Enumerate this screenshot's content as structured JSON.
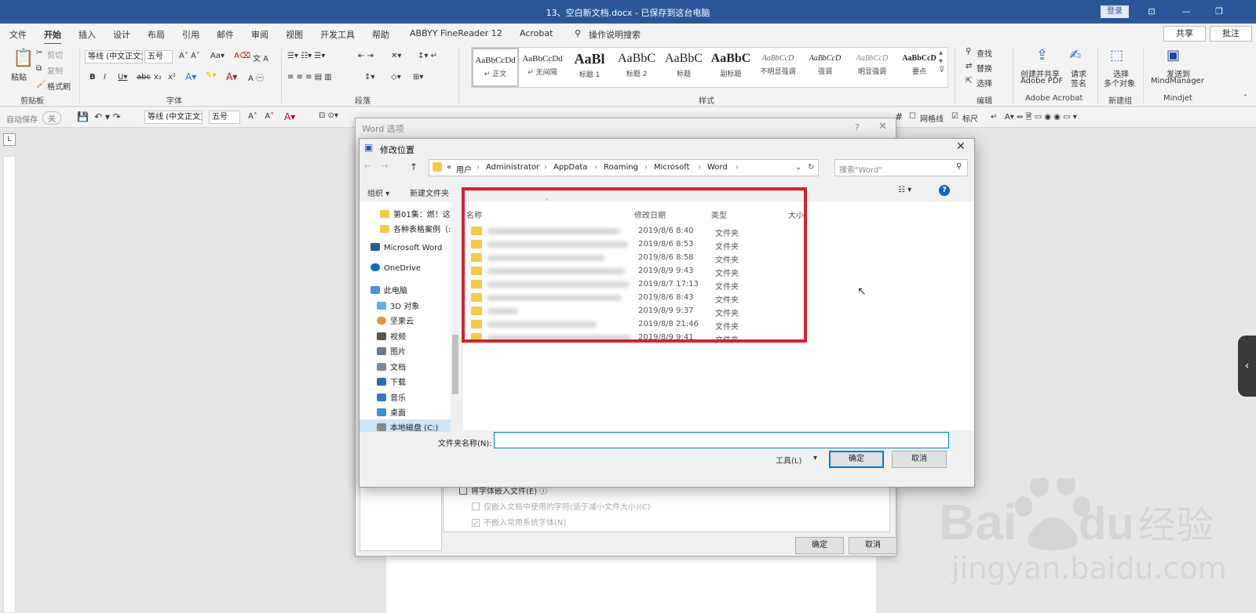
{
  "window": {
    "title": "13、空白新文档.docx - 已保存到这台电脑",
    "login": "登录",
    "controls": [
      "⊡",
      "—",
      "❐"
    ]
  },
  "menu": {
    "items": [
      "文件",
      "开始",
      "插入",
      "设计",
      "布局",
      "引用",
      "邮件",
      "审阅",
      "视图",
      "开发工具",
      "帮助",
      "ABBYY FineReader 12",
      "Acrobat"
    ],
    "active": "开始",
    "search": "操作说明搜索",
    "share": "共享",
    "comment": "批注"
  },
  "ribbon": {
    "clipboard": {
      "label": "剪贴板",
      "paste": "粘贴",
      "cut": "剪切",
      "copy": "复制",
      "format_painter": "格式刷"
    },
    "font": {
      "label": "字体",
      "name": "等线 (中文正文)",
      "size": "五号"
    },
    "paragraph": {
      "label": "段落"
    },
    "styles": {
      "label": "样式",
      "items": [
        {
          "preview": "AaBbCcDd",
          "name": "↵ 正文"
        },
        {
          "preview": "AaBbCcDd",
          "name": "↵ 无间隔"
        },
        {
          "preview": "AaBl",
          "name": "标题 1"
        },
        {
          "preview": "AaBbC",
          "name": "标题 2"
        },
        {
          "preview": "AaBbC",
          "name": "标题"
        },
        {
          "preview": "AaBbC",
          "name": "副标题"
        },
        {
          "preview": "AaBbCcD",
          "name": "不明显强调"
        },
        {
          "preview": "AaBbCcD",
          "name": "强调"
        },
        {
          "preview": "AaBbCcD",
          "name": "明显强调"
        },
        {
          "preview": "AaBbCcD",
          "name": "要点"
        }
      ]
    },
    "editing": {
      "label": "编辑",
      "find": "查找",
      "replace": "替换",
      "select": "选择"
    },
    "acrobat": {
      "label": "Adobe Acrobat",
      "create_share": "创建并共享",
      "create_share2": "Adobe PDF",
      "request_sign": "请求",
      "request_sign2": "签名"
    },
    "newgroup": {
      "label": "新建组",
      "select": "选择",
      "select2": "多个对象"
    },
    "mindjet": {
      "label": "Mindjet",
      "send": "发送到",
      "send2": "MindManager"
    }
  },
  "qat": {
    "autosave": "自动保存",
    "toggle": "关",
    "font": "等线 (中文正文)",
    "size": "五号",
    "gridlines": "网格线",
    "ruler": "标尺"
  },
  "word_options": {
    "title": "Word 选项",
    "embed_fonts": "将字体嵌入文件(E)",
    "embed_used_only": "仅嵌入文档中使用的字符(适于减小文件大小)(C)",
    "no_common_fonts": "不嵌入常用系统字体(N)",
    "ok": "确定",
    "cancel": "取消"
  },
  "dialog": {
    "title": "修改位置",
    "breadcrumb": [
      "«",
      "用户",
      "Administrator",
      "AppData",
      "Roaming",
      "Microsoft",
      "Word"
    ],
    "search_placeholder": "搜索\"Word\"",
    "organize": "组织 ▾",
    "new_folder": "新建文件夹",
    "nav": [
      {
        "label": "第01集：燃！这",
        "color": "#f6c94c"
      },
      {
        "label": "各种表格案例（:",
        "color": "#f6c94c"
      },
      {
        "label": "Microsoft Word",
        "color": "#2b579a"
      },
      {
        "label": "OneDrive",
        "color": "#0f6cbd"
      },
      {
        "label": "此电脑",
        "color": "#4a90d9"
      },
      {
        "label": "3D 对象",
        "color": "#5ab0e0"
      },
      {
        "label": "坚果云",
        "color": "#e09a30"
      },
      {
        "label": "视频",
        "color": "#555555"
      },
      {
        "label": "图片",
        "color": "#6a7a8a"
      },
      {
        "label": "文档",
        "color": "#7a8a9a"
      },
      {
        "label": "下载",
        "color": "#2b6cb0"
      },
      {
        "label": "音乐",
        "color": "#3a78c4"
      },
      {
        "label": "桌面",
        "color": "#3a8fd8"
      },
      {
        "label": "本地磁盘 (C:)",
        "color": "#888888"
      }
    ],
    "columns": [
      "名称",
      "修改日期",
      "类型",
      "大小"
    ],
    "rows": [
      {
        "date": "2019/8/6 8:40",
        "type": "文件夹"
      },
      {
        "date": "2019/8/6 8:53",
        "type": "文件夹"
      },
      {
        "date": "2019/8/6 8:58",
        "type": "文件夹"
      },
      {
        "date": "2019/8/9 9:43",
        "type": "文件夹"
      },
      {
        "date": "2019/8/7 17:13",
        "type": "文件夹"
      },
      {
        "date": "2019/8/6 8:43",
        "type": "文件夹"
      },
      {
        "date": "2019/8/9 9:37",
        "type": "文件夹"
      },
      {
        "date": "2019/8/8 21:46",
        "type": "文件夹"
      },
      {
        "date": "2019/8/9 9:41",
        "type": "文件夹"
      }
    ],
    "folder_name_label": "文件夹名称(N):",
    "folder_name_value": "",
    "tools": "工具(L)",
    "ok": "确定",
    "cancel": "取消"
  },
  "watermark": {
    "brand": "Bai",
    "brand2": "du",
    "cn": "经验",
    "url": "jingyan.baidu.com"
  },
  "colors": {
    "accent": "#2b579a",
    "highlight": "#d9212b",
    "folder": "#f6c94c"
  }
}
